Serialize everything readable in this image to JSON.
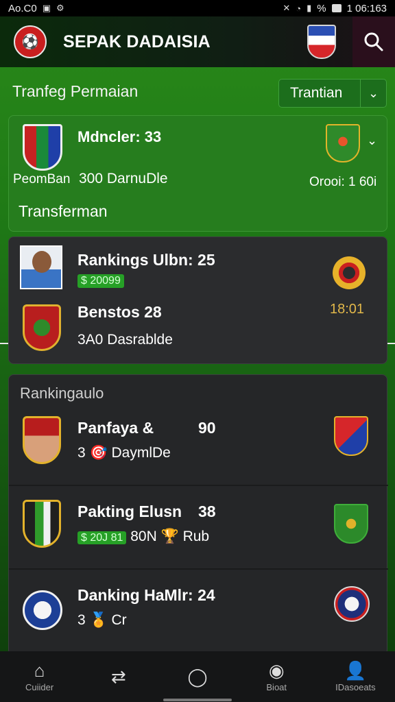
{
  "status_bar": {
    "left_text": "Ao.C0",
    "time": "1 06:163",
    "battery_percent": "%"
  },
  "app_bar": {
    "title": "SEPAK DADAISIA"
  },
  "section": {
    "title": "Tranfeg Permaian",
    "dropdown_label": "Trantian"
  },
  "transfer_card": {
    "name": "Mdncler: 33",
    "sub_left": "PeomBan",
    "sub_mid": "300  DarnuDle",
    "right_value": "Orooi: 1 60i",
    "footer": "Transferman"
  },
  "card1": {
    "name1": "Rankings Ulbn:  25",
    "badge1": "$ 20099",
    "name2": "Benstos 28",
    "sub2": "3A0  Dasrablde",
    "right_value": "18:01"
  },
  "ranking": {
    "title": "Rankingaulo",
    "rows": [
      {
        "name": "Panfaya &",
        "score": "90",
        "sub": "3 🎯 DaymlDe"
      },
      {
        "name": "Pakting Elusn",
        "score": "38",
        "badge": "$ 20J 81",
        "sub": "80N 🏆 Rub"
      },
      {
        "name": "Danking HaMlr: 24",
        "score": "",
        "sub": "3 🏅 Cr"
      }
    ]
  },
  "bottom_nav": [
    {
      "label": "Cuiider",
      "icon": "home-icon"
    },
    {
      "label": "",
      "icon": "transfer-icon"
    },
    {
      "label": "",
      "icon": "chat-icon"
    },
    {
      "label": "Bioat",
      "icon": "ball-icon"
    },
    {
      "label": "IDasoeats",
      "icon": "profile-icon"
    }
  ]
}
